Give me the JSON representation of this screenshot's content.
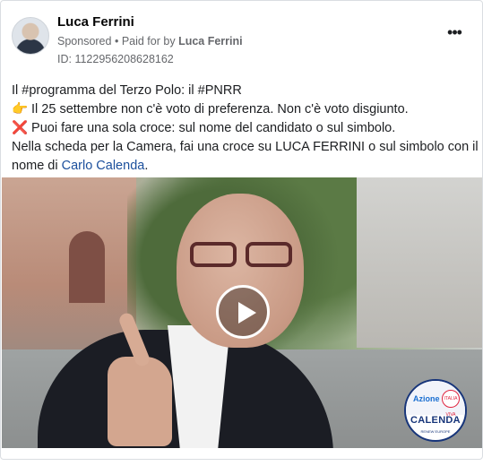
{
  "post": {
    "page_name": "Luca Ferrini",
    "sponsored_label": "Sponsored",
    "paid_prefix": "Paid for by",
    "paid_by": "Luca Ferrini",
    "ad_id": "ID: 1122956208628162",
    "more_label": "•••"
  },
  "body": {
    "line1": "Il #programma del Terzo Polo: il #PNRR",
    "line2_emoji": "👉",
    "line2": "Il 25 settembre non c'è voto di preferenza. Non c'è voto disgiunto.",
    "line3_emoji": "❌",
    "line3": "Puoi fare una sola croce: sul nome del candidato o sul simbolo.",
    "line4": "Nella scheda per la Camera, fai una croce su LUCA FERRINI o sul simbolo con il",
    "line5_prefix": "nome di",
    "line5_link": "Carlo Calenda",
    "line5_suffix": "."
  },
  "media": {
    "play_icon": "play-icon",
    "badge": {
      "azione": "Azione",
      "italia_viva": "ITALIA VIVA",
      "calenda": "CALENDA",
      "sub": "RENEW EUROPE"
    }
  }
}
